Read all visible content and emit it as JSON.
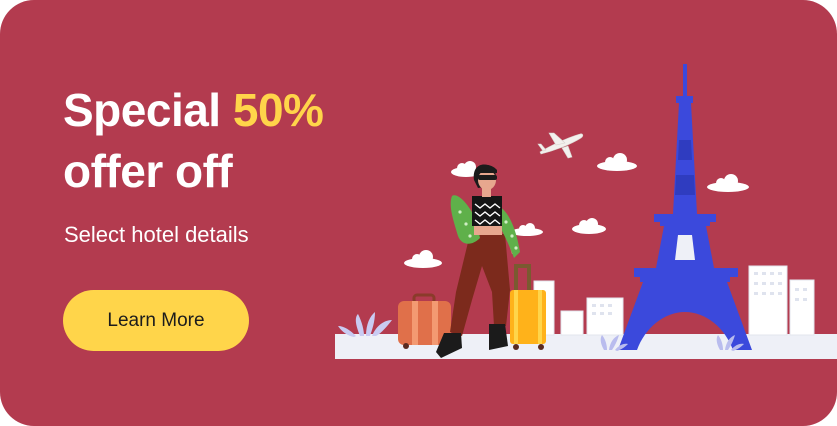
{
  "banner": {
    "headline_prefix": "Special",
    "headline_highlight": "50%",
    "headline_suffix": "offer off",
    "subtitle": "Select hotel details",
    "cta_label": "Learn More"
  },
  "colors": {
    "background": "#b33b4f",
    "highlight": "#ffd54a",
    "button": "#ffd54a",
    "text": "#ffffff",
    "tower": "#3b49dc",
    "suitcase_orange": "#e0704a",
    "suitcase_yellow": "#ffb21a"
  },
  "icons": [
    "airplane-icon",
    "cloud-icon",
    "eiffel-tower-icon",
    "suitcase-icon",
    "plant-icon",
    "building-icon"
  ]
}
